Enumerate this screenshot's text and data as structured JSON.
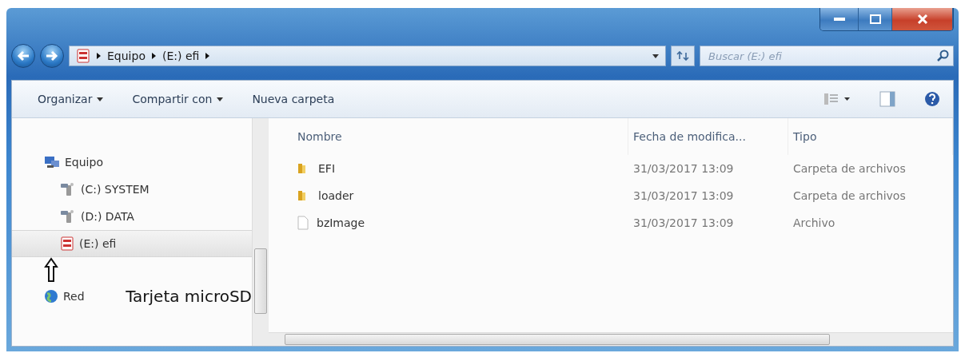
{
  "address_bar": {
    "segments": [
      "Equipo",
      "(E:) efi"
    ]
  },
  "search": {
    "placeholder": "Buscar (E:) efi"
  },
  "toolbar": {
    "items": [
      {
        "label": "Organizar",
        "dropdown": true
      },
      {
        "label": "Compartir con",
        "dropdown": true
      },
      {
        "label": "Nueva carpeta",
        "dropdown": false
      }
    ]
  },
  "sidebar": {
    "items": [
      {
        "label": "Equipo",
        "kind": "computer",
        "selected": false,
        "children": [
          {
            "label": "(C:) SYSTEM",
            "kind": "drive",
            "selected": false
          },
          {
            "label": "(D:) DATA",
            "kind": "drive",
            "selected": false
          },
          {
            "label": "(E:) efi",
            "kind": "sd",
            "selected": true
          }
        ]
      },
      {
        "label": "Red",
        "kind": "network",
        "selected": false
      }
    ]
  },
  "table": {
    "columns": [
      "Nombre",
      "Fecha de modifica...",
      "Tipo"
    ],
    "rows": [
      {
        "kind": "folder",
        "name": "EFI",
        "date": "31/03/2017 13:09",
        "type": "Carpeta de archivos"
      },
      {
        "kind": "folder",
        "name": "loader",
        "date": "31/03/2017 13:09",
        "type": "Carpeta de archivos"
      },
      {
        "kind": "file",
        "name": "bzImage",
        "date": "31/03/2017 13:09",
        "type": "Archivo"
      }
    ]
  },
  "annotation": {
    "text": "Tarjeta microSD"
  }
}
